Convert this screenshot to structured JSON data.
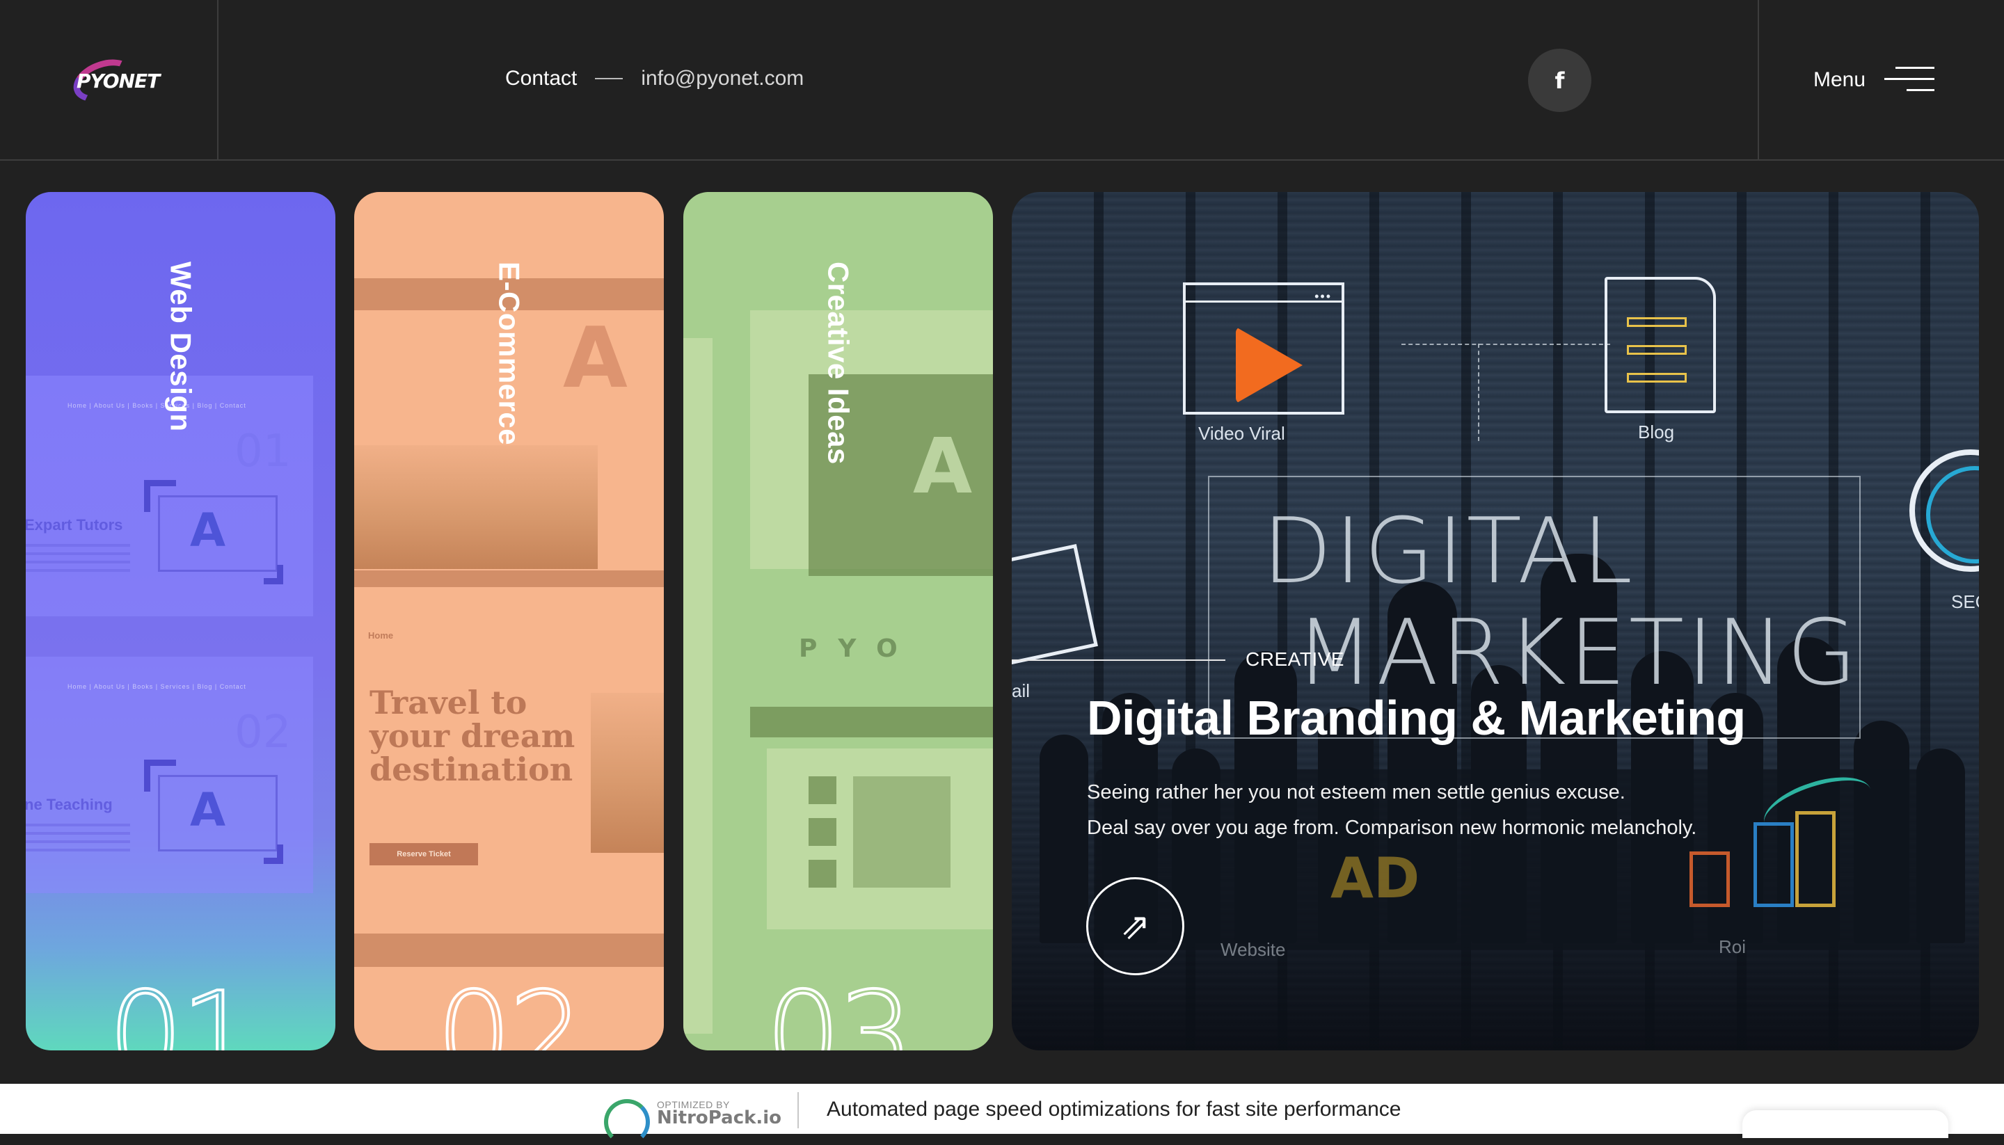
{
  "header": {
    "logo_text": "PYONET",
    "contact_label": "Contact",
    "contact_email": "info@pyonet.com",
    "social_icon": "facebook-icon",
    "social_glyph": "f",
    "menu_label": "Menu"
  },
  "cards": [
    {
      "title": "Web Design",
      "number": "01",
      "mock_nav": "Home  |  About Us  |  Books  |  Services  |  Blog  |  Contact",
      "mock_heading_1": "Expart Tutors",
      "mock_heading_2": "ne Teaching",
      "mock_num_1": "01",
      "mock_num_2": "02"
    },
    {
      "title": "E-Commerce",
      "number": "02",
      "mock_home": "Home",
      "mock_headline": "Travel to your dream destination",
      "mock_button": "Reserve Ticket"
    },
    {
      "title": "Creative Ideas",
      "number": "03",
      "mock_brand": "PYO"
    }
  ],
  "feature": {
    "label": "CREATIVE",
    "title": "Digital Branding & Marketing",
    "description_line1": "Seeing rather her you not esteem men settle genius excuse.",
    "description_line2": "Deal say over you age from. Comparison new hormonic melancholy.",
    "arrow_glyph": "⇗",
    "art": {
      "video_label": "Video Viral",
      "blog_label": "Blog",
      "word_1": "DIGITAL",
      "word_2": "MARKETING",
      "ad_label": "AD",
      "website_label": "Website",
      "roi_label": "Roi",
      "seo_label": "SEC",
      "mail_label": "ail"
    },
    "colors": {
      "play": "#f26b1f",
      "blog_lines": "#e8c24a",
      "ring": "#27a9d4"
    }
  },
  "footer": {
    "optimized_by": "OPTIMIZED BY",
    "brand": "NitroPack.io",
    "message": "Automated page speed optimizations for fast site performance"
  }
}
